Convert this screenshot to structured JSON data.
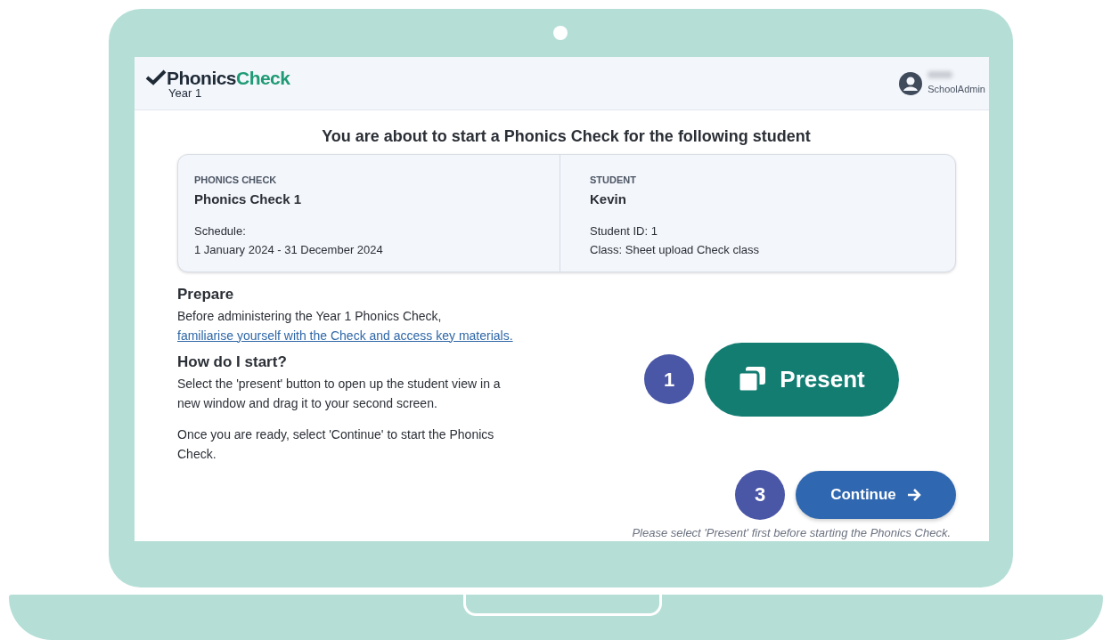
{
  "header": {
    "logo": {
      "word_1": "Phonics",
      "word_2": "Check",
      "subtitle": "Year 1"
    },
    "user": {
      "role": "SchoolAdmin"
    }
  },
  "title": "You are about to start a Phonics Check for the following student",
  "summary": [
    {
      "label": "PHONICS CHECK",
      "value": "Phonics Check 1",
      "lines": [
        "Schedule:",
        "1 January 2024 - 31 December 2024"
      ]
    },
    {
      "label": "STUDENT",
      "value": "Kevin",
      "lines": [
        "Student ID: 1",
        "Class: Sheet upload Check class"
      ]
    }
  ],
  "prepare": {
    "heading": "Prepare",
    "text": "Before administering the Year 1 Phonics Check, ",
    "link": "familiarise yourself with the Check and access key materials."
  },
  "start": {
    "heading": "How do I start?",
    "paragraphs": [
      "Select the 'present' button to open up the student view in a new window and drag it to your second screen.",
      "Once you are ready, select 'Continue' to start the Phonics Check."
    ]
  },
  "present_button": {
    "step": "1",
    "label": "Present"
  },
  "continue_button": {
    "step": "3",
    "label": "Continue"
  },
  "note": "Please select 'Present' first before starting the Phonics Check."
}
